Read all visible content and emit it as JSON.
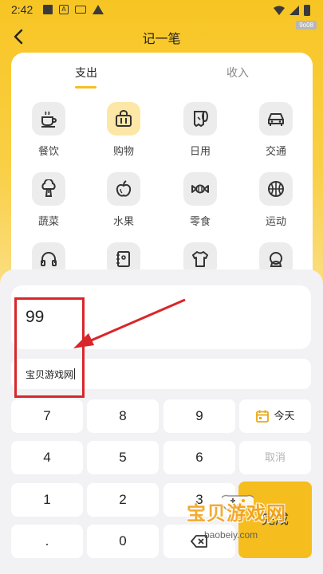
{
  "status_bar": {
    "time": "2:42",
    "clock_badge": "9o08"
  },
  "header": {
    "title": "记一笔"
  },
  "tabs": [
    {
      "label": "支出",
      "active": true
    },
    {
      "label": "收入",
      "active": false
    }
  ],
  "categories": [
    {
      "label": "餐饮",
      "icon": "coffee-cup-icon"
    },
    {
      "label": "购物",
      "icon": "shopping-bag-icon",
      "selected": true
    },
    {
      "label": "日用",
      "icon": "toilet-paper-icon"
    },
    {
      "label": "交通",
      "icon": "car-icon"
    },
    {
      "label": "蔬菜",
      "icon": "broccoli-icon"
    },
    {
      "label": "水果",
      "icon": "apple-icon"
    },
    {
      "label": "零食",
      "icon": "candy-icon"
    },
    {
      "label": "运动",
      "icon": "basketball-icon"
    },
    {
      "label": "",
      "icon": "headphones-icon"
    },
    {
      "label": "",
      "icon": "notebook-icon"
    },
    {
      "label": "",
      "icon": "tshirt-icon"
    },
    {
      "label": "",
      "icon": "beauty-icon"
    }
  ],
  "amount": {
    "value": "99"
  },
  "note": {
    "value": "宝贝游戏网"
  },
  "keypad": {
    "keys": [
      "7",
      "8",
      "9",
      "4",
      "5",
      "6",
      "1",
      "2",
      "3",
      ".",
      "0"
    ],
    "today": "今天",
    "cancel": "取消",
    "done": "完成"
  },
  "watermark": {
    "text": "宝贝游戏网",
    "url": "baobeiy.com"
  },
  "colors": {
    "accent": "#f5c022",
    "annotation": "#d9262b"
  }
}
